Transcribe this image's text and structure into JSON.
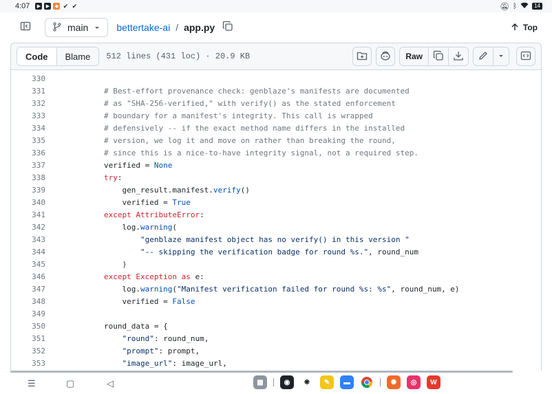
{
  "status": {
    "time": "4:07",
    "battery": "14"
  },
  "header": {
    "branch": "main",
    "repo": "bettertake-ai",
    "separator": "/",
    "file": "app.py",
    "top_label": "Top"
  },
  "toolbar": {
    "code_tab": "Code",
    "blame_tab": "Blame",
    "file_info": "512 lines (431 loc) · 20.9 KB",
    "raw_label": "Raw"
  },
  "code_lines": [
    {
      "n": "330",
      "text": ""
    },
    {
      "n": "331",
      "text": "        # Best-effort provenance check: genblaze's manifests are documented"
    },
    {
      "n": "332",
      "text": "        # as \"SHA-256-verified,\" with verify() as the stated enforcement"
    },
    {
      "n": "333",
      "text": "        # boundary for a manifest's integrity. This call is wrapped"
    },
    {
      "n": "334",
      "text": "        # defensively -- if the exact method name differs in the installed"
    },
    {
      "n": "335",
      "text": "        # version, we log it and move on rather than breaking the round,"
    },
    {
      "n": "336",
      "text": "        # since this is a nice-to-have integrity signal, not a required step."
    },
    {
      "n": "337",
      "text": "        verified = None"
    },
    {
      "n": "338",
      "text": "        try:"
    },
    {
      "n": "339",
      "text": "            gen_result.manifest.verify()"
    },
    {
      "n": "340",
      "text": "            verified = True"
    },
    {
      "n": "341",
      "text": "        except AttributeError:"
    },
    {
      "n": "342",
      "text": "            log.warning("
    },
    {
      "n": "343",
      "text": "                \"genblaze manifest object has no verify() in this version \""
    },
    {
      "n": "344",
      "text": "                \"-- skipping the verification badge for round %s.\", round_num"
    },
    {
      "n": "345",
      "text": "            )"
    },
    {
      "n": "346",
      "text": "        except Exception as e:"
    },
    {
      "n": "347",
      "text": "            log.warning(\"Manifest verification failed for round %s: %s\", round_num, e)"
    },
    {
      "n": "348",
      "text": "            verified = False"
    },
    {
      "n": "349",
      "text": ""
    },
    {
      "n": "350",
      "text": "        round_data = {"
    },
    {
      "n": "351",
      "text": "            \"round\": round_num,"
    },
    {
      "n": "352",
      "text": "            \"prompt\": prompt,"
    },
    {
      "n": "353",
      "text": "            \"image_url\": image_url,"
    }
  ],
  "icons": [
    "sidebar-icon",
    "branch-icon",
    "chevron-down-icon",
    "copy-icon",
    "arrow-up-icon",
    "add-file-icon",
    "copilot-icon",
    "download-icon",
    "pencil-icon",
    "symbols-icon"
  ],
  "colors": {
    "comment": "#6e7781",
    "keyword": "#cf222e",
    "builtin": "#0550ae",
    "string": "#0a3069",
    "func": "#8250df",
    "link": "#0969da"
  }
}
